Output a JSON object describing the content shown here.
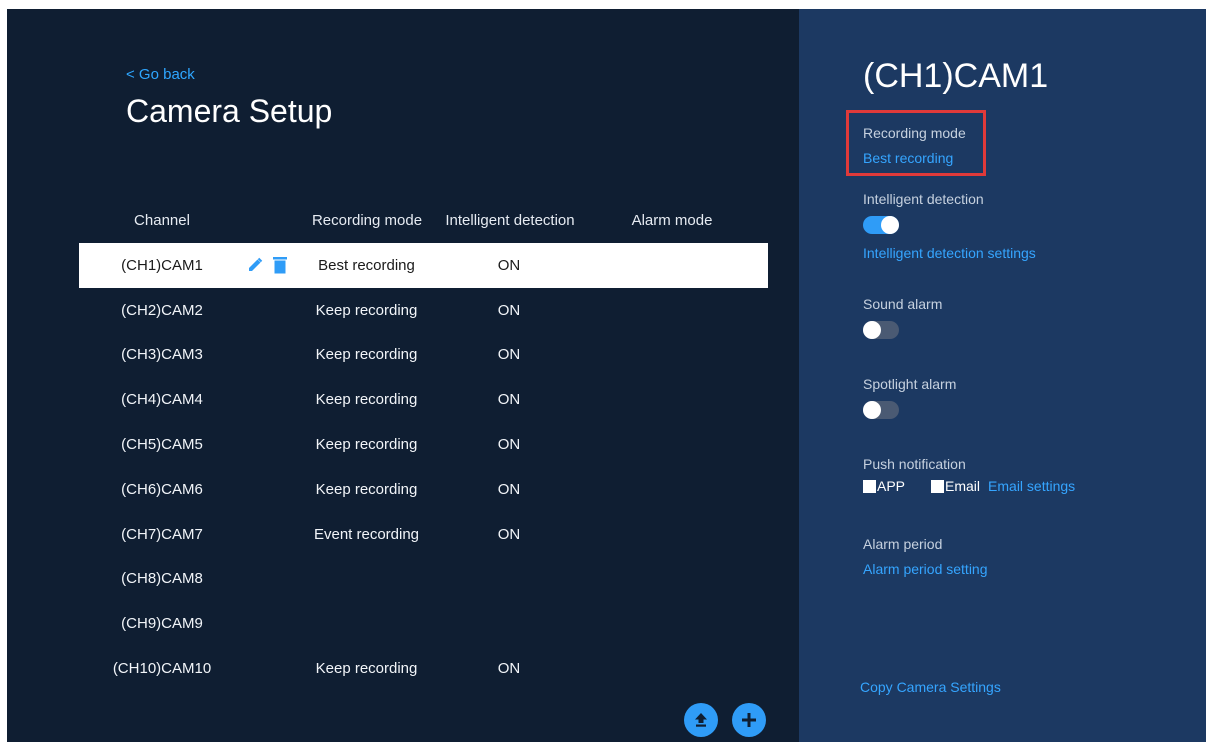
{
  "header": {
    "back_label": "< Go back",
    "title": "Camera Setup"
  },
  "table": {
    "columns": [
      "Channel",
      "Recording mode",
      "Intelligent detection",
      "Alarm mode"
    ],
    "rows": [
      {
        "channel": "(CH1)CAM1",
        "mode": "Best recording",
        "detection": "ON",
        "alarm": ""
      },
      {
        "channel": "(CH2)CAM2",
        "mode": "Keep recording",
        "detection": "ON",
        "alarm": ""
      },
      {
        "channel": "(CH3)CAM3",
        "mode": "Keep recording",
        "detection": "ON",
        "alarm": ""
      },
      {
        "channel": "(CH4)CAM4",
        "mode": "Keep recording",
        "detection": "ON",
        "alarm": ""
      },
      {
        "channel": "(CH5)CAM5",
        "mode": "Keep recording",
        "detection": "ON",
        "alarm": ""
      },
      {
        "channel": "(CH6)CAM6",
        "mode": "Keep recording",
        "detection": "ON",
        "alarm": ""
      },
      {
        "channel": "(CH7)CAM7",
        "mode": "Event recording",
        "detection": "ON",
        "alarm": ""
      },
      {
        "channel": "(CH8)CAM8",
        "mode": "",
        "detection": "",
        "alarm": ""
      },
      {
        "channel": "(CH9)CAM9",
        "mode": "",
        "detection": "",
        "alarm": ""
      },
      {
        "channel": "(CH10)CAM10",
        "mode": "Keep recording",
        "detection": "ON",
        "alarm": ""
      }
    ],
    "selected_row": 0,
    "row_icons": [
      "edit-icon",
      "delete-icon"
    ]
  },
  "actions": {
    "upload_icon": "upload-icon",
    "add_icon": "add-icon"
  },
  "detail": {
    "title": "(CH1)CAM1",
    "recording_mode_label": "Recording mode",
    "recording_mode_value": "Best recording",
    "intelligent_detection_label": "Intelligent detection",
    "intelligent_detection_on": true,
    "intelligent_detection_settings": "Intelligent detection settings",
    "sound_alarm_label": "Sound alarm",
    "sound_alarm_on": false,
    "spotlight_alarm_label": "Spotlight alarm",
    "spotlight_alarm_on": false,
    "push_notification_label": "Push notification",
    "push_app_label": "APP",
    "push_email_label": "Email",
    "email_settings": "Email settings",
    "alarm_period_label": "Alarm period",
    "alarm_period_setting": "Alarm period setting",
    "copy_settings": "Copy Camera Settings"
  },
  "colors": {
    "left_bg": "#0f1e32",
    "right_bg": "#1c3962",
    "accent": "#2f9cf7",
    "link": "#35a5ff",
    "highlight": "#e03a3a"
  }
}
